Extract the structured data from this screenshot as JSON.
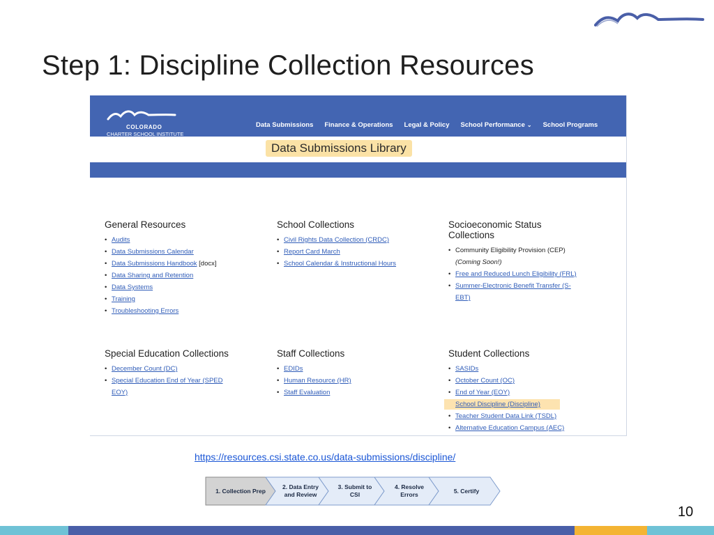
{
  "slide": {
    "title": "Step 1: Discipline Collection Resources",
    "url": "https://resources.csi.state.co.us/data-submissions/discipline/",
    "page_number": "10"
  },
  "site": {
    "logo_line1": "COLORADO",
    "logo_line2": "CHARTER SCHOOL INSTITUTE",
    "nav": [
      {
        "label": "Data Submissions"
      },
      {
        "label": "Finance & Operations"
      },
      {
        "label": "Legal & Policy"
      },
      {
        "label": "School Performance"
      },
      {
        "label": "School Programs"
      }
    ],
    "library_title": "Data Submissions Library"
  },
  "sections": {
    "general": {
      "title": "General Resources",
      "items": [
        "Audits",
        "Data Submissions Calendar",
        "Data Submissions Handbook",
        "Data Sharing and Retention",
        "Data Systems",
        "Training",
        "Troubleshooting Errors"
      ],
      "handbook_suffix": "[docx]"
    },
    "school": {
      "title": "School Collections",
      "items": [
        "Civil Rights Data Collection (CRDC)",
        "Report Card March",
        "School Calendar & Instructional Hours"
      ]
    },
    "socio": {
      "title_line1": "Socioeconomic Status",
      "title_line2": "Collections",
      "cep": "Community Eligibility Provision (CEP)",
      "coming_soon": "(Coming Soon!)",
      "frl": "Free and Reduced Lunch Eligibility (FRL)",
      "sebt_line1": "Summer-Electronic Benefit Transfer (S-",
      "sebt_line2": "EBT)"
    },
    "sped": {
      "title": "Special Education Collections",
      "dc": "December Count (DC)",
      "eoy_line1": "Special Education End of Year (SPED",
      "eoy_line2": "EOY)"
    },
    "staff": {
      "title": "Staff Collections",
      "items": [
        "EDIDs",
        "Human Resource (HR)",
        "Staff Evaluation"
      ]
    },
    "student": {
      "title": "Student Collections",
      "items": [
        "SASIDs",
        "October Count (OC)",
        "End of Year (EOY)",
        "School Discipline (Discipline)",
        "Teacher Student Data Link (TSDL)",
        "Alternative Education Campus (AEC)"
      ]
    }
  },
  "process": {
    "steps": [
      {
        "line1": "1. Collection Prep",
        "line2": ""
      },
      {
        "line1": "2. Data Entry",
        "line2": "and Review"
      },
      {
        "line1": "3. Submit to",
        "line2": "CSI"
      },
      {
        "line1": "4. Resolve",
        "line2": "Errors"
      },
      {
        "line1": "5. Certify",
        "line2": ""
      }
    ],
    "active_step": 1
  },
  "colors": {
    "header_blue": "#4365b2",
    "highlight": "#fde3b0",
    "link": "#2f5cb8",
    "chevron_active": "#d3d3d3",
    "chevron_inactive": "#e4ecf8"
  }
}
